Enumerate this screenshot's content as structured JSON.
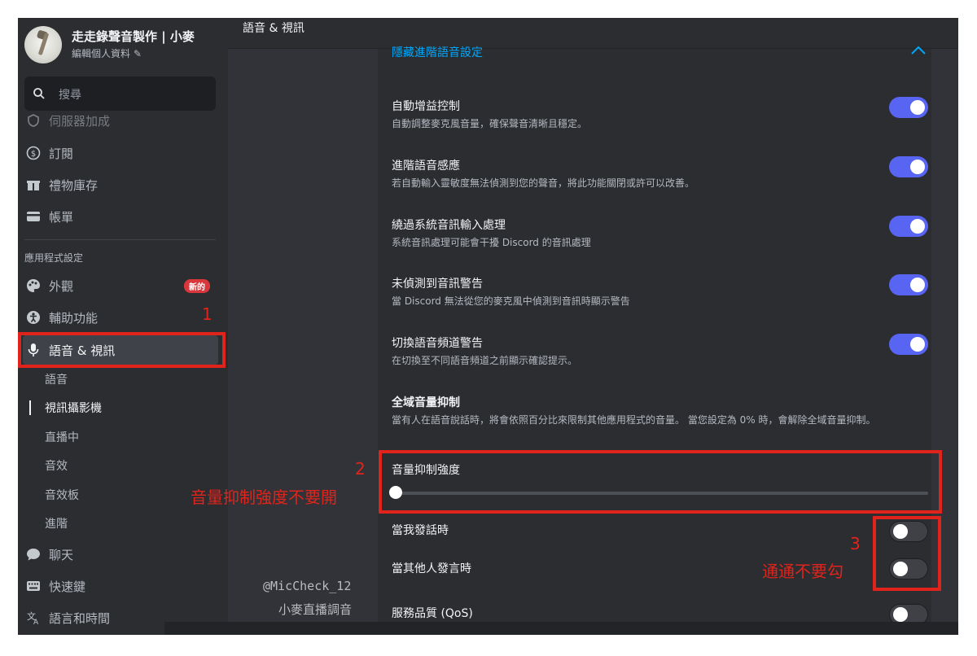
{
  "profile": {
    "name": "走走錄聲音製作 | 小麥",
    "edit_label": "編輯個人資料 ✎"
  },
  "search": {
    "placeholder": "搜尋"
  },
  "sidebar": {
    "items": [
      {
        "label": "伺服器加成",
        "icon": "shield-icon"
      },
      {
        "label": "訂閱",
        "icon": "coin-icon"
      },
      {
        "label": "禮物庫存",
        "icon": "gift-icon"
      },
      {
        "label": "帳單",
        "icon": "card-icon"
      }
    ],
    "section_header": "應用程式設定",
    "app_items": [
      {
        "label": "外觀",
        "icon": "palette-icon",
        "badge": "新的"
      },
      {
        "label": "輔助功能",
        "icon": "accessibility-icon"
      },
      {
        "label": "語音 & 視訊",
        "icon": "microphone-icon"
      }
    ],
    "sub_items": [
      "語音",
      "視訊攝影機",
      "直播中",
      "音效",
      "音效板",
      "進階"
    ],
    "more_items": [
      {
        "label": "聊天",
        "icon": "chat-icon"
      },
      {
        "label": "快速鍵",
        "icon": "keyboard-icon"
      },
      {
        "label": "語言和時間",
        "icon": "language-icon"
      }
    ]
  },
  "header": {
    "title": "語音 & 視訊"
  },
  "advanced": {
    "hide_link": "隱藏進階語音設定"
  },
  "options": [
    {
      "title": "自動增益控制",
      "desc": "自動調整麥克風音量，確保聲音清晰且穩定。",
      "enabled": true
    },
    {
      "title": "進階語音感應",
      "desc": "若自動輸入靈敏度無法偵測到您的聲音，將此功能關閉或許可以改善。",
      "enabled": true
    },
    {
      "title": "繞過系統音訊輸入處理",
      "desc": "系統音訊處理可能會干擾 Discord 的音訊處理",
      "enabled": true
    },
    {
      "title": "未偵測到音訊警告",
      "desc": "當 Discord 無法從您的麥克風中偵測到音訊時顯示警告",
      "enabled": true
    },
    {
      "title": "切換語音頻道警告",
      "desc": "在切換至不同語音頻道之前顯示確認提示。",
      "enabled": true
    }
  ],
  "attenuation": {
    "title": "全域音量抑制",
    "desc": "當有人在語音說話時，將會依照百分比來限制其他應用程式的音量。 當您設定為 0% 時，會解除全域音量抑制。",
    "slider_label": "音量抑制強度",
    "slider_value_percent": 0,
    "when_i_speak": "當我發話時",
    "when_others_speak": "當其他人發言時",
    "when_i_speak_enabled": false,
    "when_others_speak_enabled": false
  },
  "qos": {
    "title": "服務品質 (QoS)",
    "enabled": false
  },
  "annotations": {
    "n1": "1",
    "n2": "2",
    "n3": "3",
    "note2": "音量抑制強度不要開",
    "note3": "通通不要勾",
    "watermark_handle": "@MicCheck_12",
    "watermark_name": "小麥直播調音"
  },
  "colors": {
    "accent": "#5865f2",
    "link": "#00a8fc",
    "annotation": "#e0241b",
    "badge": "#da373c"
  }
}
